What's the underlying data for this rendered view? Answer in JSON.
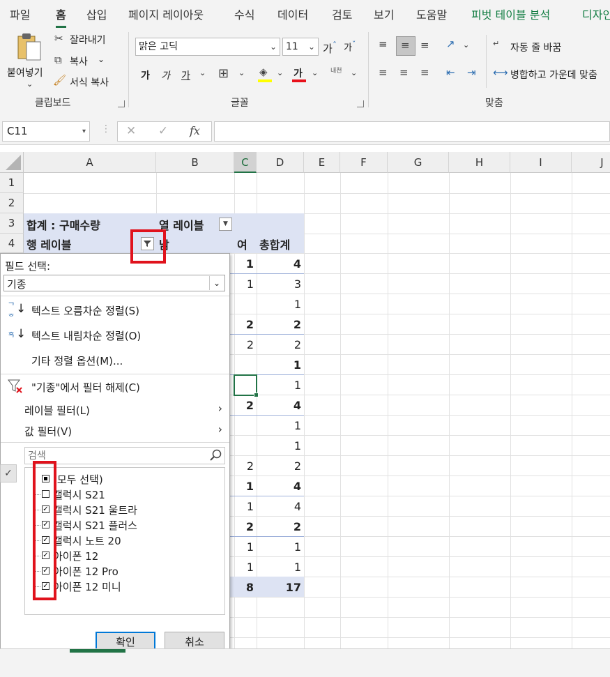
{
  "tabs": [
    "파일",
    "홈",
    "삽입",
    "페이지 레이아웃",
    "수식",
    "데이터",
    "검토",
    "보기",
    "도움말",
    "피벗 테이블 분석",
    "디자인"
  ],
  "ribbon": {
    "clipboard": {
      "paste": "붙여넣기",
      "cut": "잘라내기",
      "copy": "복사",
      "format_painter": "서식 복사",
      "label": "클립보드"
    },
    "font": {
      "name": "맑은 고딕",
      "size": "11",
      "label": "글꼴",
      "bold": "가",
      "italic": "가",
      "underline": "가",
      "grow": "가",
      "shrink": "가",
      "font_color_glyph": "가",
      "phonetic": "내천"
    },
    "alignment": {
      "wrap": "자동 줄 바꿈",
      "merge": "병합하고 가운데 맞춤",
      "label": "맞춤"
    }
  },
  "formula_bar": {
    "name_box": "C11",
    "fx": "fx",
    "value": ""
  },
  "columns": [
    "A",
    "B",
    "C",
    "D",
    "E",
    "F",
    "G",
    "H",
    "I",
    "J"
  ],
  "rows": [
    "1",
    "2",
    "3",
    "4"
  ],
  "pivot": {
    "a3": "합계 : 구매수량",
    "b3": "열 레이블",
    "a4": "행 레이블",
    "b4": "남",
    "c4": "여",
    "d4": "총합계",
    "c_values": [
      "1",
      "1",
      "",
      "2",
      "2",
      "",
      "",
      "2",
      "",
      "",
      "2",
      "1",
      "1",
      "2",
      "1",
      "1",
      "8"
    ],
    "d_values": [
      "4",
      "3",
      "1",
      "2",
      "2",
      "1",
      "1",
      "4",
      "1",
      "1",
      "2",
      "4",
      "4",
      "2",
      "1",
      "1",
      "17"
    ],
    "bold_rows": [
      0,
      3,
      5,
      7,
      11,
      13,
      16
    ]
  },
  "filter_menu": {
    "field_select_label": "필드 선택:",
    "field_value": "기종",
    "sort_asc": "텍스트 오름차순 정렬(S)",
    "sort_desc": "텍스트 내림차순 정렬(O)",
    "more_sort": "기타 정렬 옵션(M)...",
    "clear_filter": "\"기종\"에서 필터 해제(C)",
    "label_filter": "레이블 필터(L)",
    "value_filter": "값 필터(V)",
    "search_placeholder": "검색",
    "items": [
      {
        "label": "(모두 선택)",
        "state": "partial"
      },
      {
        "label": "갤럭시 S21",
        "state": "unchecked"
      },
      {
        "label": "갤럭시 S21 울트라",
        "state": "checked"
      },
      {
        "label": "갤럭시 S21 플러스",
        "state": "checked"
      },
      {
        "label": "갤럭시 노트 20",
        "state": "checked"
      },
      {
        "label": "아이폰 12",
        "state": "checked"
      },
      {
        "label": "아이폰 12 Pro",
        "state": "checked"
      },
      {
        "label": "아이폰 12 미니",
        "state": "checked"
      }
    ],
    "ok": "확인",
    "cancel": "취소"
  },
  "colors": {
    "excel_green": "#217346",
    "pivot_header": "#dde3f3",
    "highlight_red": "#e0121c"
  }
}
